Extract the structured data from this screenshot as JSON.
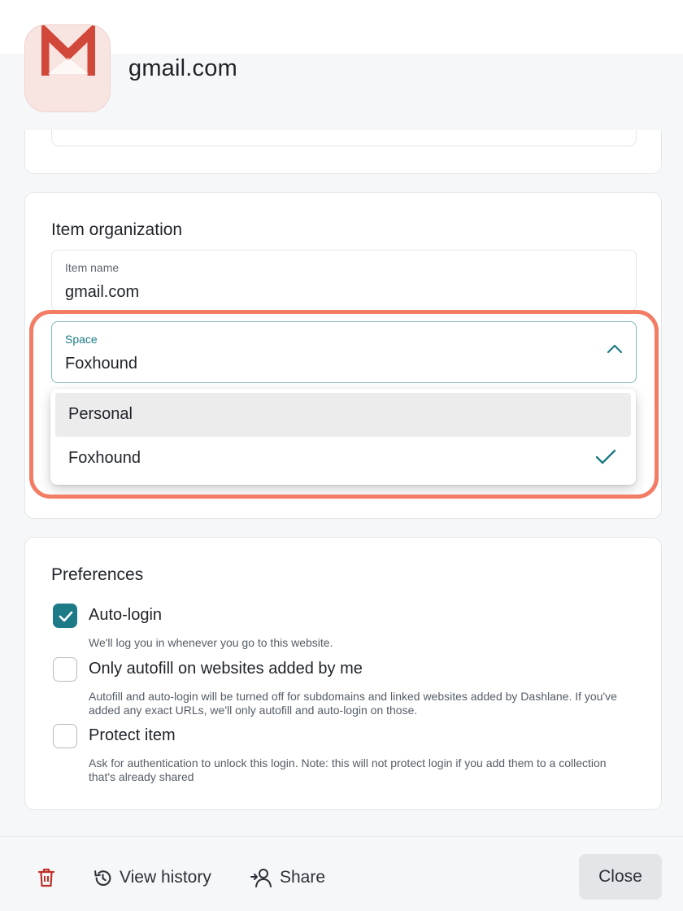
{
  "header": {
    "site_title": "gmail.com",
    "app_icon": "gmail-logo"
  },
  "item_organization": {
    "title": "Item organization",
    "item_name": {
      "label": "Item name",
      "value": "gmail.com"
    },
    "space": {
      "label": "Space",
      "value": "Foxhound",
      "chevron_icon": "chevron-up-icon",
      "options": [
        {
          "label": "Personal",
          "selected": false,
          "hovered": true
        },
        {
          "label": "Foxhound",
          "selected": true,
          "hovered": false
        }
      ]
    }
  },
  "preferences": {
    "title": "Preferences",
    "items": [
      {
        "label": "Auto-login",
        "checked": true,
        "description": "We'll log you in whenever you go to this website."
      },
      {
        "label": "Only autofill on websites added by me",
        "checked": false,
        "description": "Autofill and auto-login will be turned off for subdomains and linked websites added by Dashlane. If you've added any exact URLs, we'll only autofill and auto-login on those."
      },
      {
        "label": "Protect item",
        "checked": false,
        "description": "Ask for authentication to unlock this login. Note: this will not protect login if you add them to a collection that's already shared"
      }
    ]
  },
  "footer": {
    "delete_icon": "trash-icon",
    "view_history_label": "View history",
    "share_label": "Share",
    "close_label": "Close"
  },
  "colors": {
    "accent": "#1d7a86",
    "highlight": "#f27c64",
    "danger": "#c0312b"
  }
}
